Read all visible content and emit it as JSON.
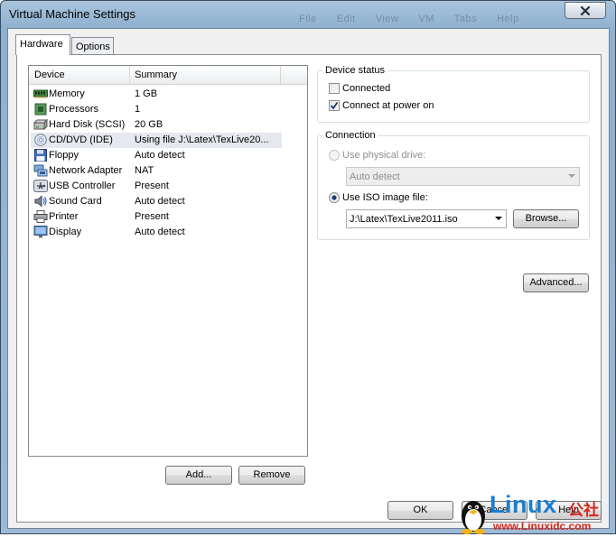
{
  "window": {
    "title": "Virtual Machine Settings",
    "ghost_menu": [
      "File",
      "Edit",
      "View",
      "VM",
      "Tabs",
      "Help"
    ]
  },
  "tabs": [
    {
      "label": "Hardware",
      "active": true
    },
    {
      "label": "Options",
      "active": false
    }
  ],
  "device_list": {
    "columns": [
      "Device",
      "Summary"
    ],
    "rows": [
      {
        "name": "Memory",
        "summary": "1 GB",
        "icon": "memory-icon"
      },
      {
        "name": "Processors",
        "summary": "1",
        "icon": "processor-icon"
      },
      {
        "name": "Hard Disk (SCSI)",
        "summary": "20 GB",
        "icon": "hard-disk-icon"
      },
      {
        "name": "CD/DVD (IDE)",
        "summary": "Using file J:\\Latex\\TexLive20...",
        "icon": "cd-dvd-icon",
        "selected": true
      },
      {
        "name": "Floppy",
        "summary": "Auto detect",
        "icon": "floppy-icon"
      },
      {
        "name": "Network Adapter",
        "summary": "NAT",
        "icon": "network-adapter-icon"
      },
      {
        "name": "USB Controller",
        "summary": "Present",
        "icon": "usb-icon"
      },
      {
        "name": "Sound Card",
        "summary": "Auto detect",
        "icon": "sound-card-icon"
      },
      {
        "name": "Printer",
        "summary": "Present",
        "icon": "printer-icon"
      },
      {
        "name": "Display",
        "summary": "Auto detect",
        "icon": "display-icon"
      }
    ]
  },
  "buttons": {
    "add": "Add...",
    "remove": "Remove",
    "browse": "Browse...",
    "advanced": "Advanced...",
    "ok": "OK",
    "cancel": "Cancel",
    "help": "Help"
  },
  "device_status": {
    "title": "Device status",
    "connected_label": "Connected",
    "connected_checked": false,
    "power_on_label": "Connect at power on",
    "power_on_checked": true
  },
  "connection": {
    "title": "Connection",
    "physical_label": "Use physical drive:",
    "physical_value": "Auto detect",
    "iso_label": "Use ISO image file:",
    "iso_value": "J:\\Latex\\TexLive2011.iso",
    "selected": "iso"
  },
  "watermark": {
    "brand": "Linux",
    "suffix": "公社",
    "url": "www.Linuxidc.com"
  },
  "colors": {
    "title_bar": "#a9c4dc",
    "dialog_bg": "#f0f0f0",
    "watermark_blue": "#1a7fd0",
    "watermark_red": "#d8261c"
  }
}
